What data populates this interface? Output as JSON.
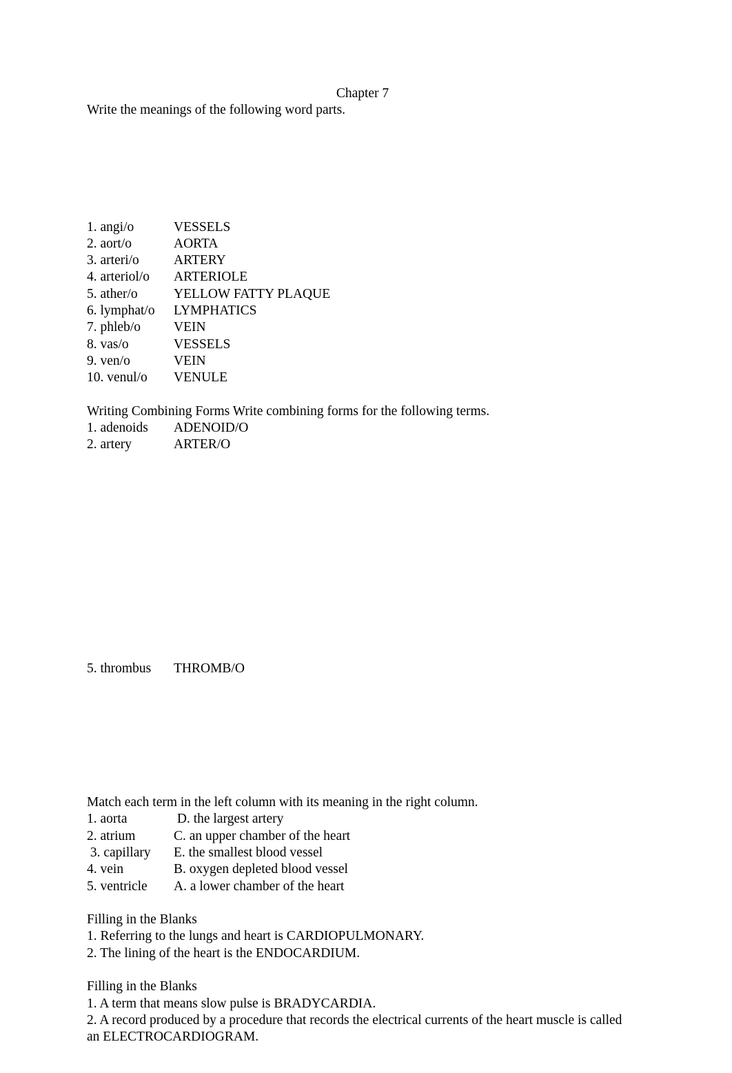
{
  "document": {
    "title": "Chapter 7",
    "sections": [
      {
        "id": "word-parts",
        "instruction": "Write the meanings of the following word parts.",
        "items": [
          {
            "term": "1. angi/o",
            "meaning": "VESSELS"
          },
          {
            "term": "2. aort/o",
            "meaning": "AORTA"
          },
          {
            "term": "3. arteri/o",
            "meaning": "ARTERY"
          },
          {
            "term": "4. arteriol/o",
            "meaning": "ARTERIOLE"
          },
          {
            "term": "5. ather/o",
            "meaning": "YELLOW FATTY PLAQUE"
          },
          {
            "term": "6. lymphat/o",
            "meaning": "LYMPHATICS"
          },
          {
            "term": "7. phleb/o",
            "meaning": "VEIN"
          },
          {
            "term": "8. vas/o",
            "meaning": "VESSELS"
          },
          {
            "term": "9. ven/o",
            "meaning": "VEIN"
          },
          {
            "term": "10. venul/o",
            "meaning": "VENULE"
          }
        ]
      },
      {
        "id": "combining-forms",
        "instruction": "Writing Combining Forms Write combining forms for the following terms.",
        "items": [
          {
            "term": "1. adenoids",
            "meaning": "ADENOID/O"
          },
          {
            "term": "2. artery",
            "meaning": "ARTER/O"
          }
        ],
        "continued_items": [
          {
            "term": "5. thrombus",
            "meaning": "THROMB/O"
          }
        ]
      },
      {
        "id": "matching",
        "instruction": "Match each term in the left column with its meaning in the right column.",
        "items": [
          {
            "term": "1. aorta",
            "meaning": " D. the largest artery"
          },
          {
            "term": "2. atrium",
            "meaning": "C. an upper chamber of the heart"
          },
          {
            "term": " 3. capillary",
            "meaning": "E. the smallest blood vessel"
          },
          {
            "term": "4. vein",
            "meaning": "B. oxygen depleted blood vessel"
          },
          {
            "term": "5. ventricle",
            "meaning": "A. a lower chamber of the heart"
          }
        ]
      },
      {
        "id": "fill-blanks-1",
        "heading": "Filling in the Blanks",
        "lines": [
          "1. Referring to the lungs and heart is CARDIOPULMONARY.",
          "2. The lining of the heart is the ENDOCARDIUM."
        ]
      },
      {
        "id": "fill-blanks-2",
        "heading": "Filling in the Blanks",
        "lines": [
          "1. A term that means slow pulse is BRADYCARDIA.",
          "2. A record produced by a procedure that records the electrical currents of the heart muscle is called an ELECTROCARDIOGRAM."
        ]
      }
    ]
  }
}
